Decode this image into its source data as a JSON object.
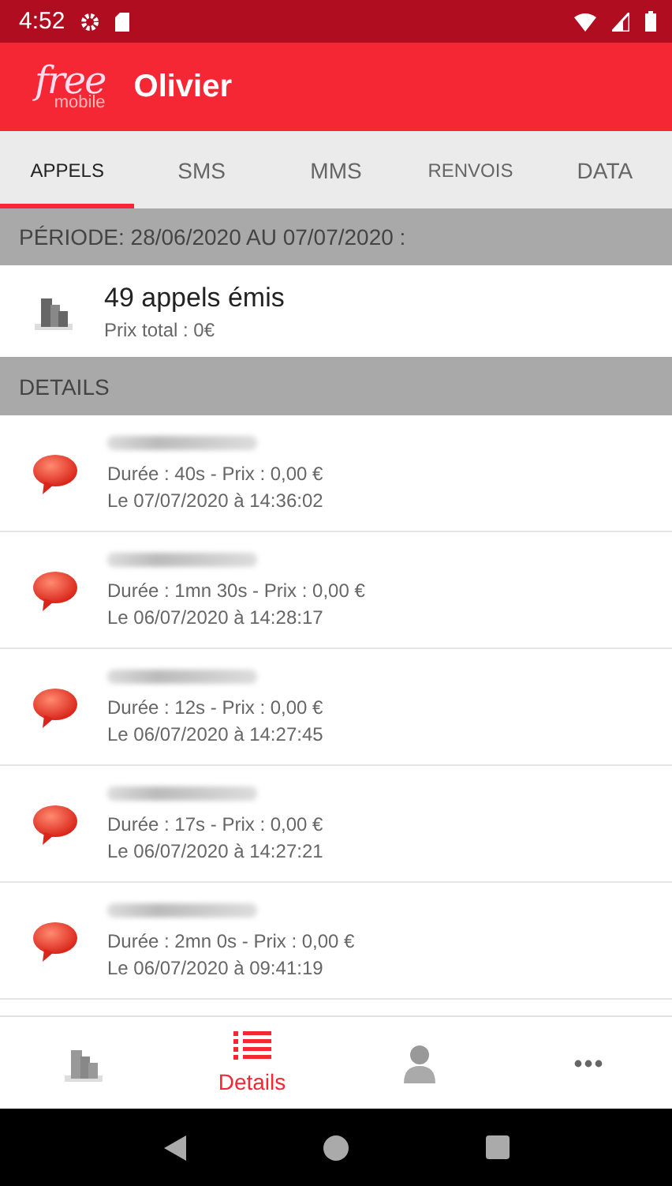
{
  "status_bar": {
    "time": "4:52"
  },
  "app_bar": {
    "logo": {
      "top": "free",
      "bottom": "mobile"
    },
    "title": "Olivier"
  },
  "tabs": [
    {
      "label": "APPELS",
      "selected": true
    },
    {
      "label": "SMS",
      "selected": false
    },
    {
      "label": "MMS",
      "selected": false
    },
    {
      "label": "RENVOIS",
      "selected": false
    },
    {
      "label": "DATA",
      "selected": false
    }
  ],
  "period_header": "PÉRIODE: 28/06/2020 AU 07/07/2020 :",
  "summary": {
    "title": "49 appels émis",
    "subtitle": "Prix total : 0€"
  },
  "details_header": "DETAILS",
  "calls": [
    {
      "duration": "Durée : 40s - Prix : 0,00 €",
      "date": "Le 07/07/2020 à 14:36:02"
    },
    {
      "duration": "Durée : 1mn 30s - Prix : 0,00 €",
      "date": "Le 06/07/2020 à 14:28:17"
    },
    {
      "duration": "Durée : 12s - Prix : 0,00 €",
      "date": "Le 06/07/2020 à 14:27:45"
    },
    {
      "duration": "Durée : 17s - Prix : 0,00 €",
      "date": "Le 06/07/2020 à 14:27:21"
    },
    {
      "duration": "Durée : 2mn 0s - Prix : 0,00 €",
      "date": "Le 06/07/2020 à 09:41:19"
    }
  ],
  "bottom_nav": [
    {
      "kind": "chart",
      "selected": false
    },
    {
      "kind": "list",
      "label": "Details",
      "selected": true
    },
    {
      "kind": "person",
      "selected": false
    },
    {
      "kind": "more",
      "selected": false
    }
  ]
}
